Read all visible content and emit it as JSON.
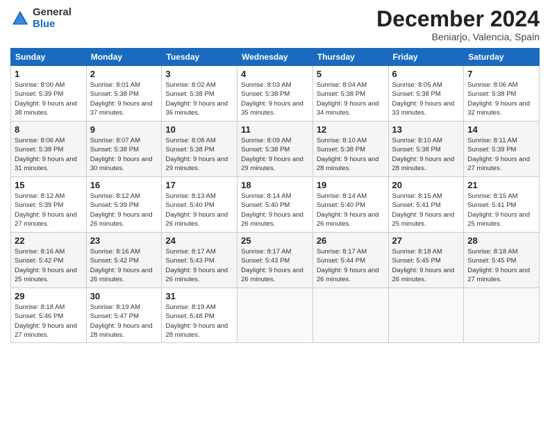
{
  "logo": {
    "general": "General",
    "blue": "Blue"
  },
  "header": {
    "month": "December 2024",
    "location": "Beniarjo, Valencia, Spain"
  },
  "weekdays": [
    "Sunday",
    "Monday",
    "Tuesday",
    "Wednesday",
    "Thursday",
    "Friday",
    "Saturday"
  ],
  "weeks": [
    [
      {
        "day": "1",
        "sunrise": "8:00 AM",
        "sunset": "5:39 PM",
        "daylight": "9 hours and 38 minutes."
      },
      {
        "day": "2",
        "sunrise": "8:01 AM",
        "sunset": "5:38 PM",
        "daylight": "9 hours and 37 minutes."
      },
      {
        "day": "3",
        "sunrise": "8:02 AM",
        "sunset": "5:38 PM",
        "daylight": "9 hours and 36 minutes."
      },
      {
        "day": "4",
        "sunrise": "8:03 AM",
        "sunset": "5:38 PM",
        "daylight": "9 hours and 35 minutes."
      },
      {
        "day": "5",
        "sunrise": "8:04 AM",
        "sunset": "5:38 PM",
        "daylight": "9 hours and 34 minutes."
      },
      {
        "day": "6",
        "sunrise": "8:05 AM",
        "sunset": "5:38 PM",
        "daylight": "9 hours and 33 minutes."
      },
      {
        "day": "7",
        "sunrise": "8:06 AM",
        "sunset": "5:38 PM",
        "daylight": "9 hours and 32 minutes."
      }
    ],
    [
      {
        "day": "8",
        "sunrise": "8:06 AM",
        "sunset": "5:38 PM",
        "daylight": "9 hours and 31 minutes."
      },
      {
        "day": "9",
        "sunrise": "8:07 AM",
        "sunset": "5:38 PM",
        "daylight": "9 hours and 30 minutes."
      },
      {
        "day": "10",
        "sunrise": "8:08 AM",
        "sunset": "5:38 PM",
        "daylight": "9 hours and 29 minutes."
      },
      {
        "day": "11",
        "sunrise": "8:09 AM",
        "sunset": "5:38 PM",
        "daylight": "9 hours and 29 minutes."
      },
      {
        "day": "12",
        "sunrise": "8:10 AM",
        "sunset": "5:38 PM",
        "daylight": "9 hours and 28 minutes."
      },
      {
        "day": "13",
        "sunrise": "8:10 AM",
        "sunset": "5:38 PM",
        "daylight": "9 hours and 28 minutes."
      },
      {
        "day": "14",
        "sunrise": "8:11 AM",
        "sunset": "5:39 PM",
        "daylight": "9 hours and 27 minutes."
      }
    ],
    [
      {
        "day": "15",
        "sunrise": "8:12 AM",
        "sunset": "5:39 PM",
        "daylight": "9 hours and 27 minutes."
      },
      {
        "day": "16",
        "sunrise": "8:12 AM",
        "sunset": "5:39 PM",
        "daylight": "9 hours and 26 minutes."
      },
      {
        "day": "17",
        "sunrise": "8:13 AM",
        "sunset": "5:40 PM",
        "daylight": "9 hours and 26 minutes."
      },
      {
        "day": "18",
        "sunrise": "8:14 AM",
        "sunset": "5:40 PM",
        "daylight": "9 hours and 26 minutes."
      },
      {
        "day": "19",
        "sunrise": "8:14 AM",
        "sunset": "5:40 PM",
        "daylight": "9 hours and 26 minutes."
      },
      {
        "day": "20",
        "sunrise": "8:15 AM",
        "sunset": "5:41 PM",
        "daylight": "9 hours and 25 minutes."
      },
      {
        "day": "21",
        "sunrise": "8:15 AM",
        "sunset": "5:41 PM",
        "daylight": "9 hours and 25 minutes."
      }
    ],
    [
      {
        "day": "22",
        "sunrise": "8:16 AM",
        "sunset": "5:42 PM",
        "daylight": "9 hours and 25 minutes."
      },
      {
        "day": "23",
        "sunrise": "8:16 AM",
        "sunset": "5:42 PM",
        "daylight": "9 hours and 26 minutes."
      },
      {
        "day": "24",
        "sunrise": "8:17 AM",
        "sunset": "5:43 PM",
        "daylight": "9 hours and 26 minutes."
      },
      {
        "day": "25",
        "sunrise": "8:17 AM",
        "sunset": "5:43 PM",
        "daylight": "9 hours and 26 minutes."
      },
      {
        "day": "26",
        "sunrise": "8:17 AM",
        "sunset": "5:44 PM",
        "daylight": "9 hours and 26 minutes."
      },
      {
        "day": "27",
        "sunrise": "8:18 AM",
        "sunset": "5:45 PM",
        "daylight": "9 hours and 26 minutes."
      },
      {
        "day": "28",
        "sunrise": "8:18 AM",
        "sunset": "5:45 PM",
        "daylight": "9 hours and 27 minutes."
      }
    ],
    [
      {
        "day": "29",
        "sunrise": "8:18 AM",
        "sunset": "5:46 PM",
        "daylight": "9 hours and 27 minutes."
      },
      {
        "day": "30",
        "sunrise": "8:19 AM",
        "sunset": "5:47 PM",
        "daylight": "9 hours and 28 minutes."
      },
      {
        "day": "31",
        "sunrise": "8:19 AM",
        "sunset": "5:48 PM",
        "daylight": "9 hours and 28 minutes."
      },
      null,
      null,
      null,
      null
    ]
  ],
  "labels": {
    "sunrise": "Sunrise:",
    "sunset": "Sunset:",
    "daylight": "Daylight:"
  }
}
